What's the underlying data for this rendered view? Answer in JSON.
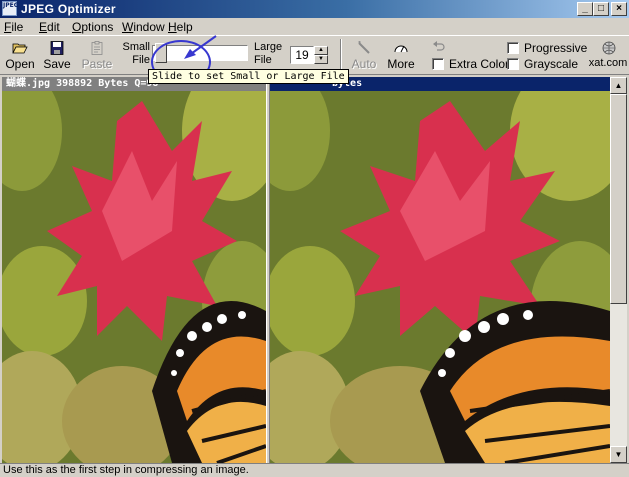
{
  "window": {
    "title": "JPEG Optimizer",
    "app_icon_text": "JPEG",
    "minimize": "_",
    "maximize": "□",
    "close": "×"
  },
  "menu": [
    "File",
    "Edit",
    "Options",
    "Window",
    "Help"
  ],
  "toolbar": {
    "open": "Open",
    "save": "Save",
    "paste": "Paste",
    "small_file": [
      "Small",
      "File"
    ],
    "large_file": [
      "Large",
      "File"
    ],
    "quality": "19",
    "auto": "Auto",
    "more": "More",
    "extra_color": "Extra Color",
    "progressive": "Progressive",
    "grayscale": "Grayscale",
    "xat": "xat.com"
  },
  "tooltip": "Slide to set Small or Large File",
  "panes": {
    "left_header": "蝴蝶.jpg 398892 Bytes Q=98",
    "right_header": "bytes"
  },
  "status": "Use this as the first step in compressing an image.",
  "colors": {
    "title_active": "#0a246a",
    "tooltip_bg": "#ffffe1",
    "annotation": "#3838d0"
  }
}
